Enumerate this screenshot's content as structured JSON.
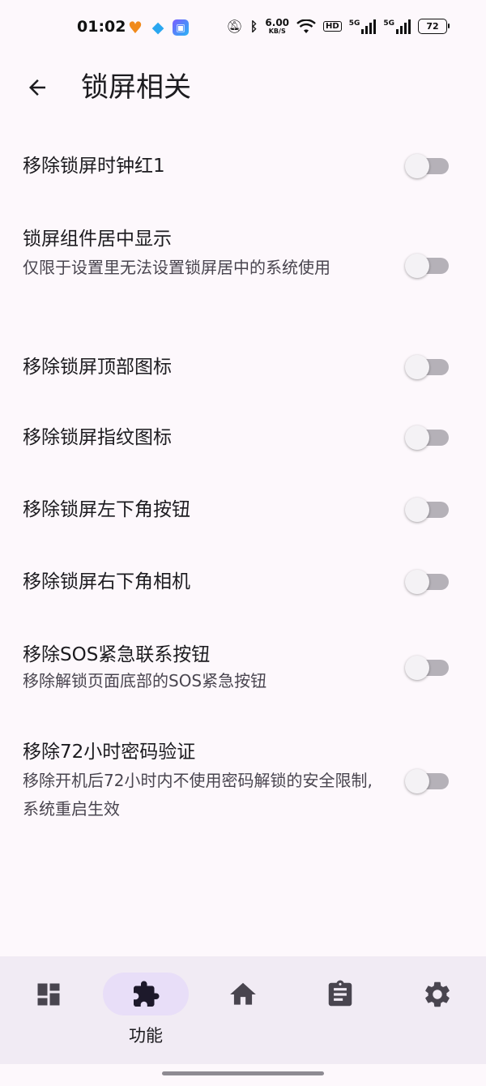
{
  "status_bar": {
    "time": "01:02",
    "speed_value": "6.00",
    "speed_unit": "KB/S",
    "hd_label": "HD",
    "sim1_label": "5G",
    "sim2_label": "5G",
    "battery": "72",
    "icons": [
      "heart-app-icon",
      "qq-icon",
      "app-icon",
      "mute-icon",
      "bluetooth-icon",
      "wifi-icon",
      "hd-icon",
      "signal-icon",
      "signal-icon",
      "battery-icon"
    ]
  },
  "header": {
    "back_icon": "arrow-back-icon",
    "title": "锁屏相关"
  },
  "settings": [
    {
      "title": "移除锁屏时钟红1",
      "summary": "",
      "enabled": false
    },
    {
      "title": "锁屏组件居中显示",
      "summary": "仅限于设置里无法设置锁屏居中的系统使用",
      "enabled": false
    },
    {
      "title": "移除锁屏顶部图标",
      "summary": "",
      "enabled": false
    },
    {
      "title": "移除锁屏指纹图标",
      "summary": "",
      "enabled": false
    },
    {
      "title": "移除锁屏左下角按钮",
      "summary": "",
      "enabled": false
    },
    {
      "title": "移除锁屏右下角相机",
      "summary": "",
      "enabled": false
    },
    {
      "title": "移除SOS紧急联系按钮",
      "summary": "移除解锁页面底部的SOS紧急按钮",
      "enabled": false
    },
    {
      "title": "移除72小时密码验证",
      "summary": "移除开机后72小时内不使用密码解锁的安全限制, 系统重启生效",
      "enabled": false
    }
  ],
  "bottom_nav": {
    "items": [
      {
        "icon": "dashboard-icon",
        "label": ""
      },
      {
        "icon": "puzzle-icon",
        "label": "功能",
        "active": true
      },
      {
        "icon": "home-icon",
        "label": ""
      },
      {
        "icon": "clipboard-icon",
        "label": ""
      },
      {
        "icon": "gear-icon",
        "label": ""
      }
    ]
  },
  "colors": {
    "background": "#fdf8fc",
    "nav_background": "#f1ebf4",
    "active_pill": "#e8def8",
    "switch_track": "#b5b1b8",
    "switch_thumb": "#f4f2f5"
  }
}
